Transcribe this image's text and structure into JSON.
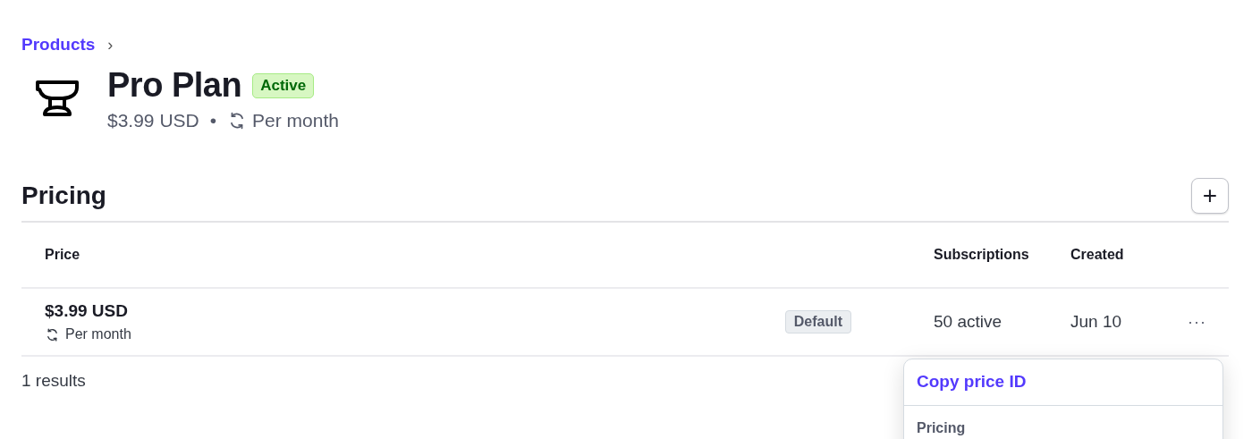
{
  "breadcrumb": {
    "label": "Products",
    "separator": "›"
  },
  "product": {
    "name": "Pro Plan",
    "status": "Active",
    "price": "$3.99 USD",
    "separator": "•",
    "interval": "Per month"
  },
  "pricing": {
    "title": "Pricing",
    "add_button": "+",
    "columns": [
      "Price",
      "Subscriptions",
      "Created"
    ],
    "rows": [
      {
        "price": "$3.99 USD",
        "interval": "Per month",
        "badge": "Default",
        "subscriptions": "50 active",
        "created": "Jun 10",
        "more": "···"
      }
    ],
    "footer": "1 results"
  },
  "menu": {
    "items": [
      {
        "label": "Copy price ID",
        "kind": "action"
      },
      {
        "label": "Pricing",
        "kind": "section"
      }
    ]
  }
}
